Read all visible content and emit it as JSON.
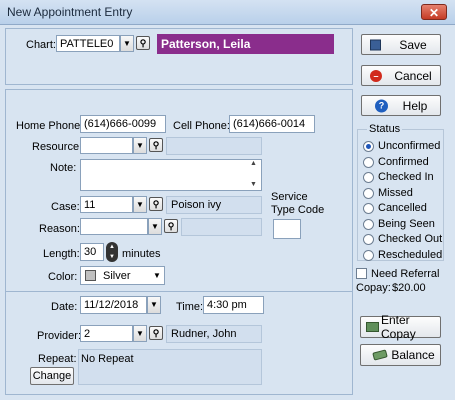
{
  "window": {
    "title": "New Appointment Entry",
    "close_glyph": "✕"
  },
  "chart": {
    "label": "Chart:",
    "value": "PATTELE0",
    "patient_name": "Patterson, Leila",
    "patient_bg": "#8a2d8c"
  },
  "phones": {
    "home_label": "Home Phone:",
    "home_value": "(614)666-0099",
    "cell_label": "Cell Phone:",
    "cell_value": "(614)666-0014"
  },
  "resource": {
    "label": "Resource:",
    "value": ""
  },
  "note": {
    "label": "Note:",
    "value": ""
  },
  "case": {
    "label": "Case:",
    "value": "11",
    "description": "Poison ivy"
  },
  "service_type": {
    "label_line1": "Service",
    "label_line2": "Type Code",
    "value": ""
  },
  "reason": {
    "label": "Reason:",
    "value": ""
  },
  "length": {
    "label": "Length:",
    "value": "30",
    "unit": "minutes"
  },
  "color": {
    "label": "Color:",
    "value": "Silver",
    "swatch": "#c0c0c0"
  },
  "date": {
    "label": "Date:",
    "value": "11/12/2018"
  },
  "time": {
    "label": "Time:",
    "value": "4:30 pm"
  },
  "provider": {
    "label": "Provider:",
    "value": "2",
    "name": "Rudner, John"
  },
  "repeat": {
    "label": "Repeat:",
    "value": "No Repeat",
    "change_label": "Change"
  },
  "buttons": {
    "save": "Save",
    "cancel": "Cancel",
    "help": "Help",
    "enter_copay": "Enter Copay",
    "balance": "Balance"
  },
  "status": {
    "title": "Status",
    "options": [
      "Unconfirmed",
      "Confirmed",
      "Checked In",
      "Missed",
      "Cancelled",
      "Being Seen",
      "Checked Out",
      "Rescheduled"
    ],
    "selected": "Unconfirmed"
  },
  "referral": {
    "label": "Need Referral",
    "checked": false
  },
  "copay": {
    "label": "Copay:",
    "value": "$20.00"
  },
  "icons": {
    "dropdown": "chevron-down-icon",
    "search": "magnifier-icon",
    "save": "floppy-icon",
    "cancel": "no-entry-icon",
    "help": "question-icon",
    "copay": "money-icon",
    "balance": "cash-icon"
  }
}
